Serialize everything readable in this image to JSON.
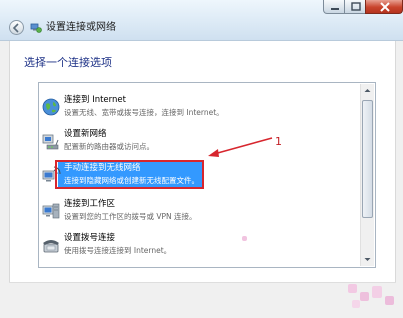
{
  "window": {
    "title": "设置连接或网络"
  },
  "page": {
    "heading": "选择一个连接选项"
  },
  "options": [
    {
      "title": "连接到 Internet",
      "desc": "设置无线、宽带或拨号连接，连接到 Internet。",
      "icon": "globe-icon",
      "selected": false
    },
    {
      "title": "设置新网络",
      "desc": "配置新的路由器或访问点。",
      "icon": "router-icon",
      "selected": false
    },
    {
      "title": "手动连接到无线网络",
      "desc": "连接到隐藏网络或创建新无线配置文件。",
      "icon": "wireless-icon",
      "selected": true
    },
    {
      "title": "连接到工作区",
      "desc": "设置到您的工作区的拨号或 VPN 连接。",
      "icon": "workplace-icon",
      "selected": false
    },
    {
      "title": "设置拨号连接",
      "desc": "使用拨号连接连接到 Internet。",
      "icon": "phone-icon",
      "selected": false
    }
  ],
  "annotation": {
    "number": "1",
    "color": "#d7262e"
  },
  "colors": {
    "selection": "#3399ff",
    "heading": "#1e3287"
  }
}
